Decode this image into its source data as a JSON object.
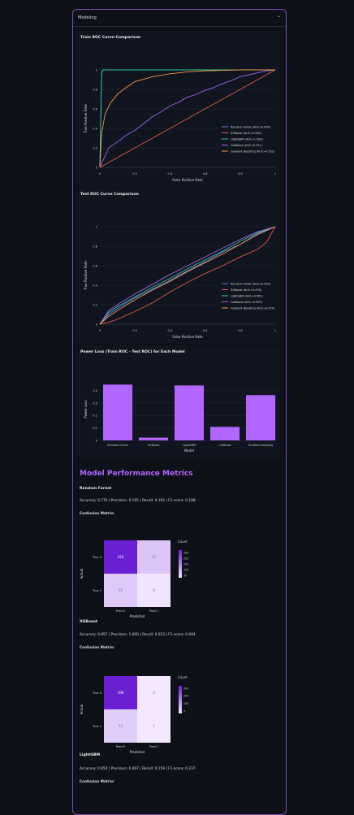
{
  "expander": {
    "title": "Modeling"
  },
  "roc_train": {
    "title": "Train ROC Curve Comparison",
    "xlabel": "False Positive Rate",
    "ylabel": "True Positive Rate",
    "xticks": [
      "0",
      "0.2",
      "0.4",
      "0.6",
      "0.8",
      "1"
    ],
    "yticks": [
      "0",
      "0.2",
      "0.4",
      "0.6",
      "0.8",
      "1"
    ]
  },
  "roc_test": {
    "title": "Test ROC Curve Comparison",
    "xlabel": "False Positive Rate",
    "ylabel": "True Positive Rate",
    "xticks": [
      "0",
      "0.2",
      "0.4",
      "0.6",
      "0.8",
      "1"
    ],
    "yticks": [
      "0",
      "0.2",
      "0.4",
      "0.6",
      "0.8",
      "1"
    ]
  },
  "power_loss": {
    "title": "Power Loss (Train ROC - Test ROC) for Each Model",
    "xlabel": "Model",
    "ylabel": "Power Loss",
    "yticks": [
      "0",
      "0.1",
      "0.2",
      "0.3",
      "0.4"
    ]
  },
  "chart_data": [
    {
      "type": "line",
      "title": "Train ROC Curve Comparison",
      "xlabel": "False Positive Rate",
      "ylabel": "True Positive Rate",
      "xlim": [
        0,
        1
      ],
      "ylim": [
        0,
        1
      ],
      "legend_position": "bottom-right",
      "series": [
        {
          "name": "Random Forest (AUC=0.999)",
          "color": "#6f7be6",
          "x": [
            0,
            0.01,
            0.02,
            1
          ],
          "y": [
            0,
            0.97,
            1,
            1
          ]
        },
        {
          "name": "XGBoost (AUC=0.500)",
          "color": "#e0584a",
          "x": [
            0,
            1
          ],
          "y": [
            0,
            1
          ]
        },
        {
          "name": "LightGBM (AUC=1.000)",
          "color": "#2fc79b",
          "x": [
            0,
            0.01,
            0.02,
            1
          ],
          "y": [
            0,
            0.98,
            1,
            1
          ]
        },
        {
          "name": "CatBoost (AUC=0.701)",
          "color": "#9d63e8",
          "x": [
            0,
            0.05,
            0.1,
            0.15,
            0.2,
            0.25,
            0.3,
            0.35,
            0.4,
            0.45,
            0.5,
            0.55,
            0.6,
            0.65,
            0.7,
            0.75,
            0.8,
            0.85,
            0.9,
            0.95,
            1
          ],
          "y": [
            0,
            0.2,
            0.26,
            0.33,
            0.38,
            0.45,
            0.52,
            0.57,
            0.63,
            0.67,
            0.72,
            0.75,
            0.79,
            0.82,
            0.86,
            0.89,
            0.93,
            0.95,
            0.97,
            0.99,
            1
          ]
        },
        {
          "name": "Gradient Boosting (AUC=0.932)",
          "color": "#f2994a",
          "x": [
            0,
            0.01,
            0.03,
            0.06,
            0.1,
            0.15,
            0.2,
            0.3,
            0.4,
            0.5,
            0.6,
            0.7,
            0.8,
            0.9,
            1
          ],
          "y": [
            0,
            0.35,
            0.55,
            0.66,
            0.75,
            0.82,
            0.88,
            0.93,
            0.96,
            0.98,
            0.99,
            0.995,
            1,
            1,
            1
          ]
        }
      ]
    },
    {
      "type": "line",
      "title": "Test ROC Curve Comparison",
      "xlabel": "False Positive Rate",
      "ylabel": "True Positive Rate",
      "xlim": [
        0,
        1
      ],
      "ylim": [
        0,
        1
      ],
      "legend_position": "bottom-right",
      "series": [
        {
          "name": "Random Forest (AUC=0.553)",
          "color": "#6f7be6",
          "x": [
            0,
            0.05,
            0.1,
            0.2,
            0.3,
            0.4,
            0.5,
            0.6,
            0.7,
            0.8,
            0.9,
            1
          ],
          "y": [
            0,
            0.1,
            0.16,
            0.27,
            0.36,
            0.45,
            0.55,
            0.64,
            0.74,
            0.82,
            0.93,
            1
          ]
        },
        {
          "name": "XGBoost (AUC=0.478)",
          "color": "#e0584a",
          "x": [
            0,
            0.05,
            0.1,
            0.2,
            0.3,
            0.4,
            0.5,
            0.6,
            0.7,
            0.8,
            0.9,
            0.95,
            1
          ],
          "y": [
            0,
            0.02,
            0.05,
            0.13,
            0.22,
            0.33,
            0.43,
            0.52,
            0.6,
            0.69,
            0.77,
            0.84,
            1
          ]
        },
        {
          "name": "LightGBM (AUC=0.561)",
          "color": "#2fc79b",
          "x": [
            0,
            0.05,
            0.1,
            0.2,
            0.3,
            0.4,
            0.5,
            0.6,
            0.7,
            0.8,
            0.9,
            1
          ],
          "y": [
            0,
            0.12,
            0.18,
            0.28,
            0.38,
            0.47,
            0.57,
            0.66,
            0.75,
            0.85,
            0.94,
            1
          ]
        },
        {
          "name": "CatBoost (AUC=0.593)",
          "color": "#9d63e8",
          "x": [
            0,
            0.05,
            0.1,
            0.2,
            0.3,
            0.4,
            0.5,
            0.6,
            0.7,
            0.8,
            0.9,
            1
          ],
          "y": [
            0,
            0.14,
            0.2,
            0.31,
            0.41,
            0.51,
            0.6,
            0.69,
            0.78,
            0.87,
            0.95,
            1
          ]
        },
        {
          "name": "Gradient Boosting (AUC=0.570)",
          "color": "#f2994a",
          "x": [
            0,
            0.05,
            0.1,
            0.2,
            0.3,
            0.4,
            0.5,
            0.6,
            0.7,
            0.8,
            0.9,
            1
          ],
          "y": [
            0,
            0.08,
            0.14,
            0.25,
            0.35,
            0.44,
            0.54,
            0.63,
            0.72,
            0.82,
            0.92,
            1
          ]
        }
      ]
    },
    {
      "type": "bar",
      "title": "Power Loss (Train ROC - Test ROC) for Each Model",
      "xlabel": "Model",
      "ylabel": "Power Loss",
      "ylim": [
        0,
        0.5
      ],
      "categories": [
        "Random Forest",
        "XGBoost",
        "LightGBM",
        "CatBoost",
        "Gradient Boosting"
      ],
      "values": [
        0.446,
        0.022,
        0.439,
        0.108,
        0.362
      ],
      "color": "#b266ff"
    }
  ],
  "metrics": {
    "section_title": "Model Performance Metrics",
    "models": [
      {
        "name": "Random Forest",
        "summary": "Accuracy: 0.770 | Precision: 0.195 | Recall: 0.162 | F1-score: 0.188",
        "cm_label": "Confusion Matrix:",
        "matrix": [
          [
            320,
            55
          ],
          [
            50,
            8
          ]
        ],
        "colorbar_ticks": [
          "300",
          "250",
          "150",
          "100",
          "50"
        ]
      },
      {
        "name": "XGBoost",
        "summary": "Accuracy: 0.857 | Precision: 1.000 | Recall: 0.023 | F1-score: 0.044",
        "cm_label": "Confusion Matrix:",
        "matrix": [
          [
            398,
            0
          ],
          [
            53,
            1
          ]
        ],
        "colorbar_ticks": [
          "300",
          "200",
          "100",
          "0"
        ]
      },
      {
        "name": "LightGBM",
        "summary": "Accuracy: 0.850 | Precision: 0.467 | Recall: 0.159 | F1-score: 0.237",
        "cm_label": "Confusion Matrix:"
      }
    ],
    "cm_axes": {
      "xlabel": "Predicted",
      "ylabel": "Actual",
      "xticks": [
        "Pred 0",
        "Pred 1"
      ],
      "yticks": [
        "True 0",
        "True 1"
      ],
      "colorbar_title": "Count"
    }
  }
}
